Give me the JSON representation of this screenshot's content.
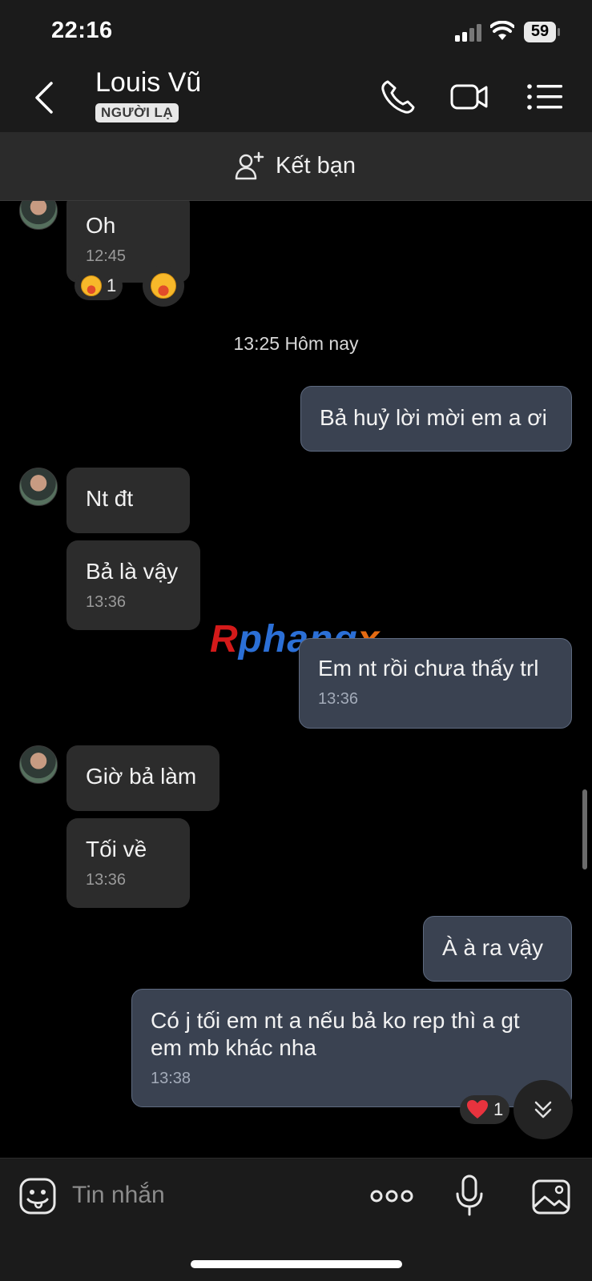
{
  "status_bar": {
    "time": "22:16",
    "battery": "59"
  },
  "header": {
    "contact_name": "Louis Vũ",
    "badge": "NGƯỜI LẠ"
  },
  "friend_bar": {
    "label": "Kết bạn"
  },
  "chat": {
    "date_separator": "13:25 Hôm nay",
    "messages": [
      {
        "dir": "in",
        "text": "Oh",
        "time": "12:45"
      },
      {
        "dir": "out",
        "text": "Bả huỷ lời mời em a ơi",
        "time": ""
      },
      {
        "dir": "in",
        "text": "Nt đt",
        "time": ""
      },
      {
        "dir": "in",
        "text": "Bả là vậy",
        "time": "13:36"
      },
      {
        "dir": "out",
        "text": "Em nt rồi chưa thấy trl",
        "time": "13:36"
      },
      {
        "dir": "in",
        "text": "Giờ bả làm",
        "time": ""
      },
      {
        "dir": "in",
        "text": "Tối về",
        "time": "13:36"
      },
      {
        "dir": "out",
        "text": "À à ra vậy",
        "time": ""
      },
      {
        "dir": "out",
        "text": "Có j tối em nt a nếu bả ko rep thì a gt em mb khác nha",
        "time": "13:38"
      }
    ],
    "reactions": {
      "oh_count": "1",
      "last_heart_count": "1"
    },
    "watermark": {
      "part1": "R",
      "part2": "phang",
      "part3": "x"
    }
  },
  "input": {
    "placeholder": "Tin nhắn"
  },
  "colors": {
    "incoming": "#2c2c2c",
    "outgoing": "#3a4251",
    "background": "#000000"
  },
  "icons": [
    "back-icon",
    "phone-icon",
    "video-call-icon",
    "menu-icon",
    "add-friend-icon",
    "sticker-icon",
    "more-icon",
    "mic-icon",
    "image-icon",
    "scroll-down-icon"
  ]
}
